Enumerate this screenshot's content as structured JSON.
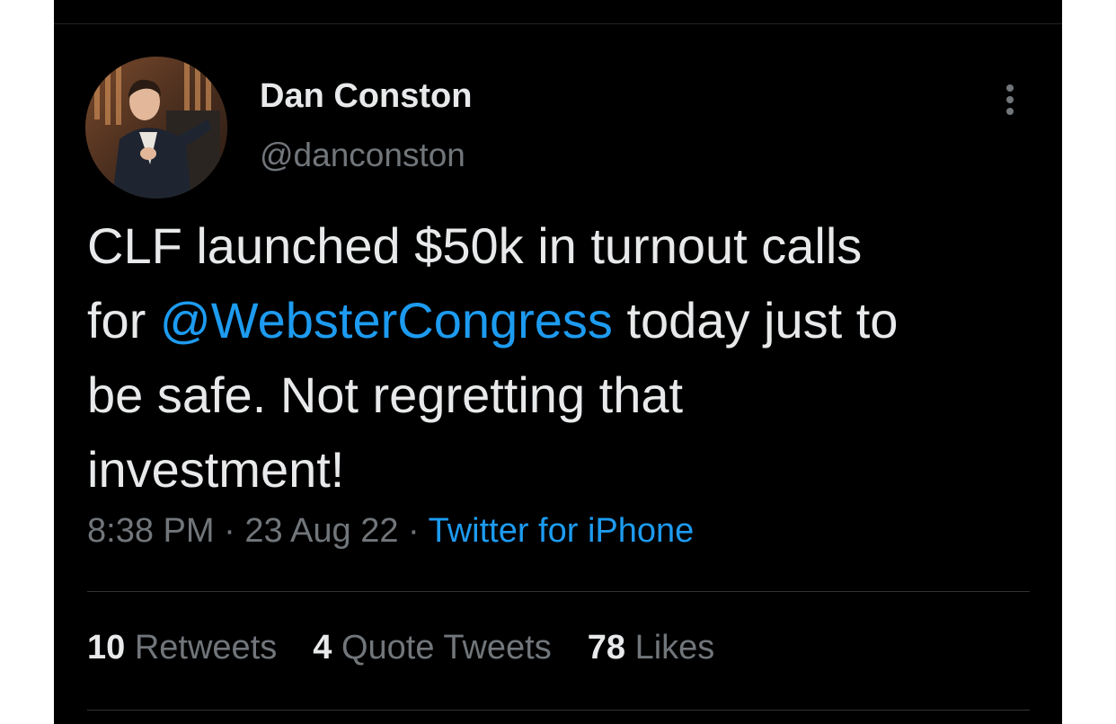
{
  "tweet": {
    "author": {
      "display_name": "Dan Conston",
      "handle": "@danconston"
    },
    "text_lines": {
      "line1": "CLF launched $50k in turnout calls",
      "line2_prefix": "for ",
      "line2_mention": "@WebsterCongress",
      "line2_suffix": " today just to",
      "line3": "be safe. Not regretting that",
      "line4": "investment!"
    },
    "meta": {
      "time": "8:38 PM",
      "separator": " · ",
      "date": "23 Aug 22",
      "source": "Twitter for iPhone"
    },
    "stats": {
      "retweets_count": "10",
      "retweets_label": "Retweets",
      "quotes_count": "4",
      "quotes_label": "Quote Tweets",
      "likes_count": "78",
      "likes_label": "Likes"
    }
  },
  "colors": {
    "background": "#000000",
    "primary_text": "#e7e9ea",
    "secondary_text": "#71767b",
    "link": "#1d9bf0",
    "divider": "#2f3336"
  },
  "icons": {
    "more": "more-vertical-icon"
  }
}
